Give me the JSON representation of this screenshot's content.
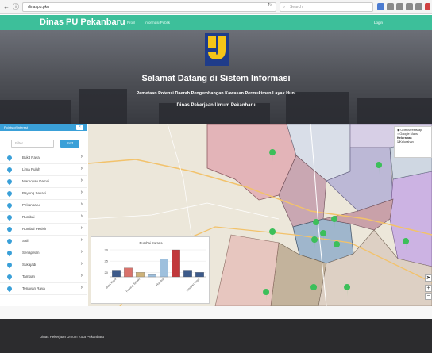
{
  "browser": {
    "url": "dinaspu.pku",
    "search_placeholder": "Search"
  },
  "navbar": {
    "brand": "Dinas PU Pekanbaru",
    "links": [
      "Profil",
      "Informasi Publik"
    ],
    "login": "Login"
  },
  "hero": {
    "title": "Selamat Datang di Sistem Informasi",
    "subtitle": "Pemetaan Potensi Daerah Pengembangan Kawasan Permukiman Layak Huni",
    "subtitle2": "Dinas Pekerjaan Umum Pekanbaru"
  },
  "sidebar": {
    "header": "Points of Interest",
    "close": "×",
    "filter_placeholder": "Filter",
    "sort_label": "Sort",
    "items": [
      {
        "label": "Bukit Raya"
      },
      {
        "label": "Lima Puluh"
      },
      {
        "label": "Marpoyan Damai"
      },
      {
        "label": "Payung Sekaki"
      },
      {
        "label": "Pekanbaru"
      },
      {
        "label": "Rumbai"
      },
      {
        "label": "Rumbai Pesisir"
      },
      {
        "label": "Sail"
      },
      {
        "label": "Senapelan"
      },
      {
        "label": "Sukajadi"
      },
      {
        "label": "Tampan"
      },
      {
        "label": "Tenayan Raya"
      }
    ]
  },
  "map_control": {
    "base_options": [
      "OpenStreetMap",
      "Google Maps"
    ],
    "selected_base": "OpenStreetMap",
    "section_label": "Kelurahan",
    "layer_label": "Kelurahan",
    "zoom_in": "+",
    "zoom_out": "−",
    "locate": "➤"
  },
  "chart_data": {
    "type": "bar",
    "title": "Rumbai Sarana",
    "ylim": [
      0,
      30
    ],
    "yticks": [
      20,
      25,
      30
    ],
    "categories": [
      "Bukit Raya",
      "",
      "Payung Sekaki",
      "",
      "Rumbai",
      "",
      "",
      "Tenayan Raya"
    ],
    "values": [
      21,
      22,
      20,
      19,
      26,
      30,
      21,
      20
    ],
    "colors": [
      "#3c5a8a",
      "#d9726b",
      "#cdb27a",
      "#9ec0dd",
      "#9ec0dd",
      "#c1393c",
      "#3c5a8a",
      "#3c5a8a"
    ],
    "grid": true
  },
  "footer": {
    "text": "Dinas Pekerjaan Umum Kota Pekanbaru"
  },
  "colors": {
    "accent_green": "#3dbf9a",
    "accent_blue": "#3aa0d8",
    "footer_dark": "#2c2c2e"
  }
}
